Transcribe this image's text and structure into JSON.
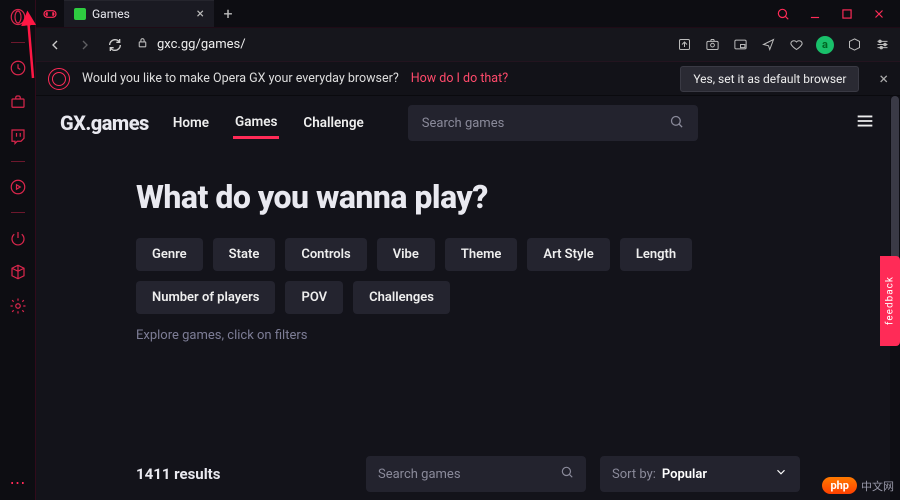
{
  "tab": {
    "title": "Games"
  },
  "address": {
    "url": "gxc.gg/games/"
  },
  "promo": {
    "text": "Would you like to make Opera GX your everyday browser?",
    "link": "How do I do that?",
    "button": "Yes, set it as default browser"
  },
  "site": {
    "logo": "GX.games",
    "nav": {
      "home": "Home",
      "games": "Games",
      "challenge": "Challenge"
    },
    "search_placeholder": "Search games"
  },
  "hero": "What do you wanna play?",
  "chips": {
    "genre": "Genre",
    "state": "State",
    "controls": "Controls",
    "vibe": "Vibe",
    "theme": "Theme",
    "art": "Art Style",
    "length": "Length",
    "players": "Number of players",
    "pov": "POV",
    "challenges": "Challenges"
  },
  "explore": "Explore games, click on filters",
  "results": {
    "count": "1411 results",
    "search_placeholder": "Search games",
    "sort_label": "Sort by:",
    "sort_value": "Popular"
  },
  "feedback": "feedback",
  "watermark": {
    "brand": "php",
    "cn": "中文网"
  }
}
